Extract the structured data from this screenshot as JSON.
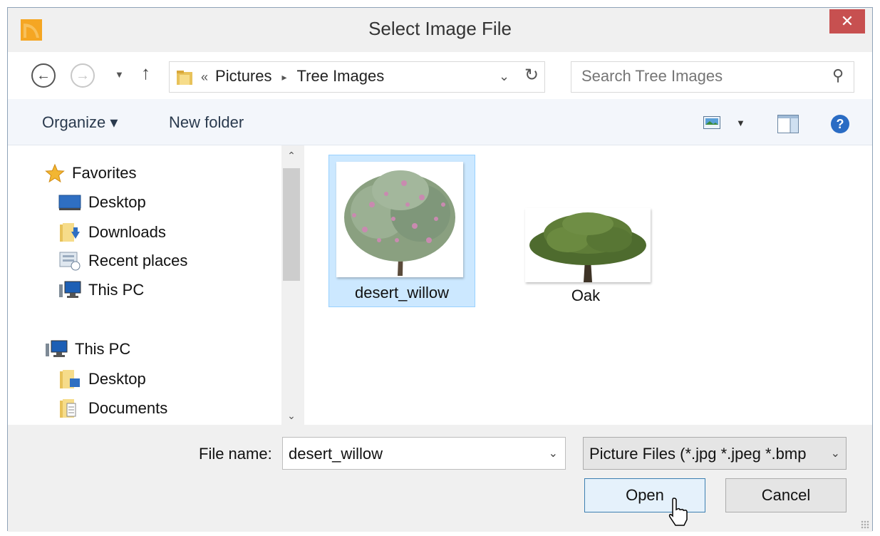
{
  "window": {
    "title": "Select Image File",
    "close_glyph": "✕",
    "accent": "#c75050"
  },
  "nav": {
    "back_icon": "←",
    "forward_icon": "→",
    "recent_icon": "▼",
    "up_icon": "↑",
    "breadcrumb_overflow": "«",
    "breadcrumb": [
      "Pictures",
      "Tree Images"
    ],
    "breadcrumb_sep": "▸",
    "address_dropdown_icon": "⌄",
    "refresh_icon": "↻",
    "search_placeholder": "Search Tree Images",
    "search_icon": "⚲"
  },
  "toolbar": {
    "organize_label": "Organize ▾",
    "new_folder_label": "New folder",
    "view_dropdown_icon": "▼",
    "help_glyph": "?"
  },
  "sidebar": {
    "items": [
      {
        "label": "Favorites",
        "icon": "star-icon"
      },
      {
        "label": "Desktop",
        "icon": "desktop-icon"
      },
      {
        "label": "Downloads",
        "icon": "downloads-folder-icon"
      },
      {
        "label": "Recent places",
        "icon": "recent-places-icon"
      },
      {
        "label": "This PC",
        "icon": "computer-icon"
      },
      {
        "label": "This PC",
        "icon": "computer-icon"
      },
      {
        "label": "Desktop",
        "icon": "desktop-folder-icon"
      },
      {
        "label": "Documents",
        "icon": "documents-folder-icon"
      }
    ],
    "scroll_up": "⌃",
    "scroll_down": "⌄"
  },
  "files": [
    {
      "name": "desert_willow",
      "selected": true
    },
    {
      "name": "Oak",
      "selected": false
    }
  ],
  "footer": {
    "file_name_label": "File name:",
    "file_name_value": "desert_willow",
    "file_name_dropdown": "⌄",
    "filter_label": "Picture Files (*.jpg *.jpeg *.bmp",
    "filter_dropdown": "⌄",
    "open_label": "Open",
    "cancel_label": "Cancel"
  }
}
